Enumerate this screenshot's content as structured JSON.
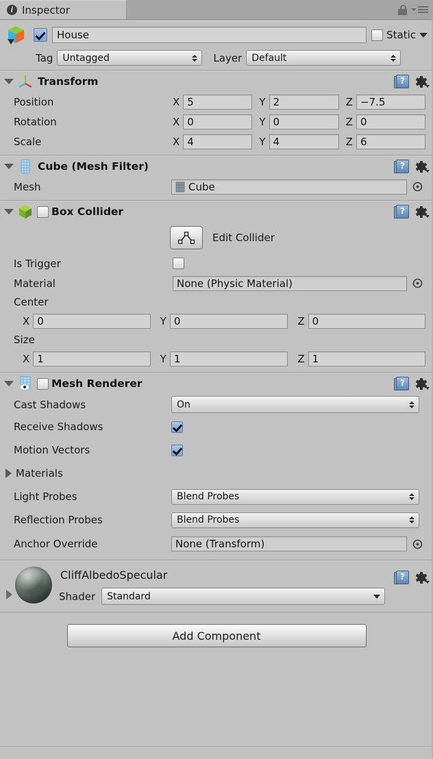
{
  "window": {
    "tab_label": "Inspector",
    "tab_icon": "info-icon",
    "lock_icon": "lock-icon",
    "menu_icon": "hamburger-menu-icon"
  },
  "object_header": {
    "icon": "gameobject-cube-icon",
    "enabled": true,
    "name": "House",
    "static_label": "Static",
    "static_checked": false,
    "tag_label": "Tag",
    "tag_value": "Untagged",
    "layer_label": "Layer",
    "layer_value": "Default"
  },
  "components": [
    {
      "title": "Transform",
      "icon": "transform-axis-icon",
      "expanded": true,
      "has_enable_checkbox": false,
      "help_icon": "help-book-icon",
      "gear_icon": "settings-gear-icon",
      "vectors": [
        {
          "label": "Position",
          "x": "5",
          "y": "2",
          "z": "−7.5"
        },
        {
          "label": "Rotation",
          "x": "0",
          "y": "0",
          "z": "0"
        },
        {
          "label": "Scale",
          "x": "4",
          "y": "4",
          "z": "6"
        }
      ],
      "axis_labels": [
        "X",
        "Y",
        "Z"
      ]
    },
    {
      "title": "Cube (Mesh Filter)",
      "icon": "mesh-filter-icon",
      "expanded": true,
      "has_enable_checkbox": false,
      "help_icon": "help-book-icon",
      "gear_icon": "settings-gear-icon",
      "mesh_label": "Mesh",
      "mesh_value": "Cube",
      "mesh_value_icon": "mesh-asset-icon",
      "picker_icon": "object-picker-icon"
    },
    {
      "title": "Box Collider",
      "icon": "box-collider-icon",
      "expanded": true,
      "has_enable_checkbox": true,
      "enabled": true,
      "help_icon": "help-book-icon",
      "gear_icon": "settings-gear-icon",
      "edit_collider_label": "Edit Collider",
      "edit_collider_icon": "edit-collider-icon",
      "is_trigger_label": "Is Trigger",
      "is_trigger_checked": false,
      "material_label": "Material",
      "material_value": "None (Physic Material)",
      "picker_icon": "object-picker-icon",
      "center_label": "Center",
      "center": {
        "x": "0",
        "y": "0",
        "z": "0"
      },
      "size_label": "Size",
      "size": {
        "x": "1",
        "y": "1",
        "z": "1"
      },
      "axis_labels": [
        "X",
        "Y",
        "Z"
      ]
    },
    {
      "title": "Mesh Renderer",
      "icon": "mesh-renderer-icon",
      "expanded": true,
      "has_enable_checkbox": true,
      "enabled": true,
      "help_icon": "help-book-icon",
      "gear_icon": "settings-gear-icon",
      "cast_shadows_label": "Cast Shadows",
      "cast_shadows_value": "On",
      "receive_shadows_label": "Receive Shadows",
      "receive_shadows_checked": true,
      "motion_vectors_label": "Motion Vectors",
      "motion_vectors_checked": true,
      "materials_label": "Materials",
      "materials_expanded": false,
      "light_probes_label": "Light Probes",
      "light_probes_value": "Blend Probes",
      "reflection_probes_label": "Reflection Probes",
      "reflection_probes_value": "Blend Probes",
      "anchor_override_label": "Anchor Override",
      "anchor_override_value": "None (Transform)",
      "picker_icon": "object-picker-icon"
    }
  ],
  "material_block": {
    "preview_icon": "material-sphere-preview",
    "name": "CliffAlbedoSpecular",
    "shader_label": "Shader",
    "shader_value": "Standard",
    "expanded": false,
    "help_icon": "help-book-icon",
    "gear_icon": "settings-gear-icon"
  },
  "footer": {
    "add_component_label": "Add Component"
  },
  "colors": {
    "panel_bg": "#c2c2c2",
    "tabbar_bg": "#a5a5a5",
    "field_bg": "#d3d3d3",
    "checkbox_checked": "#7ca5d6",
    "text": "#1b1b1b"
  }
}
